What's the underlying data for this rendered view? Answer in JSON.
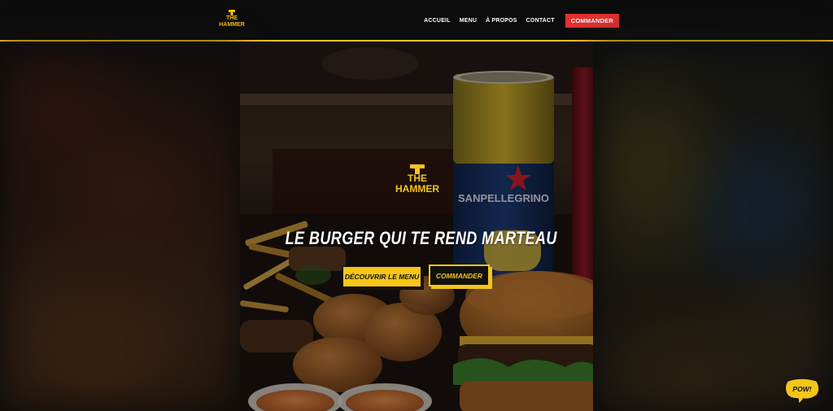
{
  "brand": {
    "name_line1": "THE",
    "name_line2": "HAMMER",
    "accent_color": "#f5c518",
    "cta_color": "#e63030"
  },
  "nav": {
    "items": [
      {
        "label": "ACCUEIL"
      },
      {
        "label": "MENU"
      },
      {
        "label": "À PROPOS"
      },
      {
        "label": "CONTACT"
      }
    ],
    "cta_label": "COMMANDER"
  },
  "hero": {
    "tagline": "LE BURGER QUI TE REND MARTEAU",
    "primary_button": "DÉCOUVRIR LE MENU",
    "secondary_button": "COMMANDER",
    "can_brand": "SANPELLEGRINO"
  },
  "chat_badge": {
    "label": "POW!"
  }
}
